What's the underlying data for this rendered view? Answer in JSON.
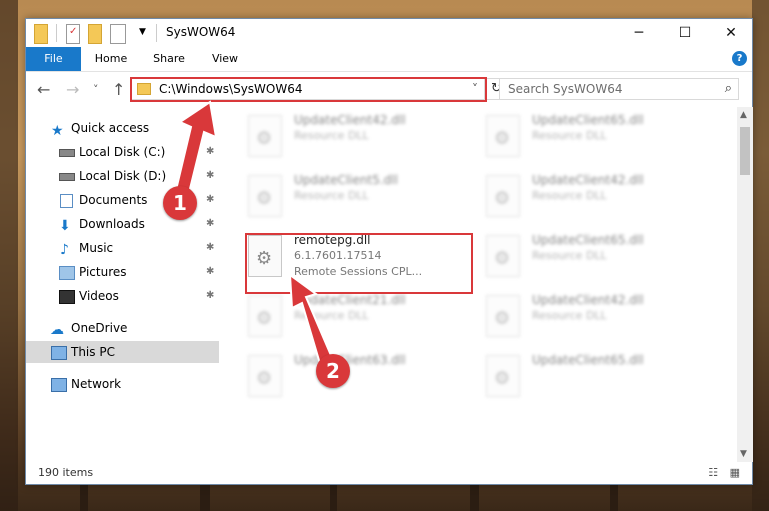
{
  "titlebar": {
    "title": "SysWOW64",
    "minimize": "─",
    "maximize": "☐",
    "close": "✕"
  },
  "ribbon": {
    "tabs": [
      "File",
      "Home",
      "Share",
      "View"
    ],
    "help": "?"
  },
  "nav_buttons": {
    "back": "←",
    "forward": "→",
    "recent": "˅",
    "up": "↑"
  },
  "address": {
    "path": "C:\\Windows\\SysWOW64",
    "dropdown": "˅",
    "refresh": "↻"
  },
  "search": {
    "placeholder": "Search SysWOW64",
    "icon": "⌕"
  },
  "sidebar": {
    "items": [
      {
        "label": "Quick access",
        "icon": "star-icon"
      },
      {
        "label": "Local Disk (C:)",
        "icon": "drive-icon"
      },
      {
        "label": "Local Disk (D:)",
        "icon": "drive-icon"
      },
      {
        "label": "Documents",
        "icon": "documents-icon"
      },
      {
        "label": "Downloads",
        "icon": "download-icon"
      },
      {
        "label": "Music",
        "icon": "music-icon"
      },
      {
        "label": "Pictures",
        "icon": "pictures-icon"
      },
      {
        "label": "Videos",
        "icon": "videos-icon"
      },
      {
        "label": "OneDrive",
        "icon": "cloud-icon"
      },
      {
        "label": "This PC",
        "icon": "computer-icon"
      },
      {
        "label": "Network",
        "icon": "network-icon"
      }
    ],
    "pin": "✱"
  },
  "files": [
    {
      "name": "UpdateClient42.dll",
      "type": "Resource DLL"
    },
    {
      "name": "UpdateClient65.dll",
      "type": "Resource DLL"
    },
    {
      "name": "UpdateClient5.dll",
      "type": "Resource DLL"
    },
    {
      "name": "UpdateClient42.dll",
      "type": "Resource DLL"
    },
    {
      "name": "remotepg.dll",
      "version": "6.1.7601.17514",
      "type": "Remote Sessions CPL..."
    },
    {
      "name": "UpdateClient65.dll",
      "type": "Resource DLL"
    },
    {
      "name": "UpdateClient21.dll",
      "type": "Resource DLL"
    },
    {
      "name": "UpdateClient42.dll",
      "type": "Resource DLL"
    },
    {
      "name": "UpdateClient63.dll",
      "type": "Resource DLL"
    },
    {
      "name": "UpdateClient65.dll",
      "type": "Resource DLL"
    }
  ],
  "status": {
    "count": "190 items",
    "view_icons": "☷ ▦"
  },
  "scrollbar": {
    "up": "▲",
    "down": "▼"
  },
  "annotations": {
    "step1": "1",
    "step2": "2"
  },
  "colors": {
    "accent": "#1979ca",
    "highlight": "#d9383a"
  }
}
